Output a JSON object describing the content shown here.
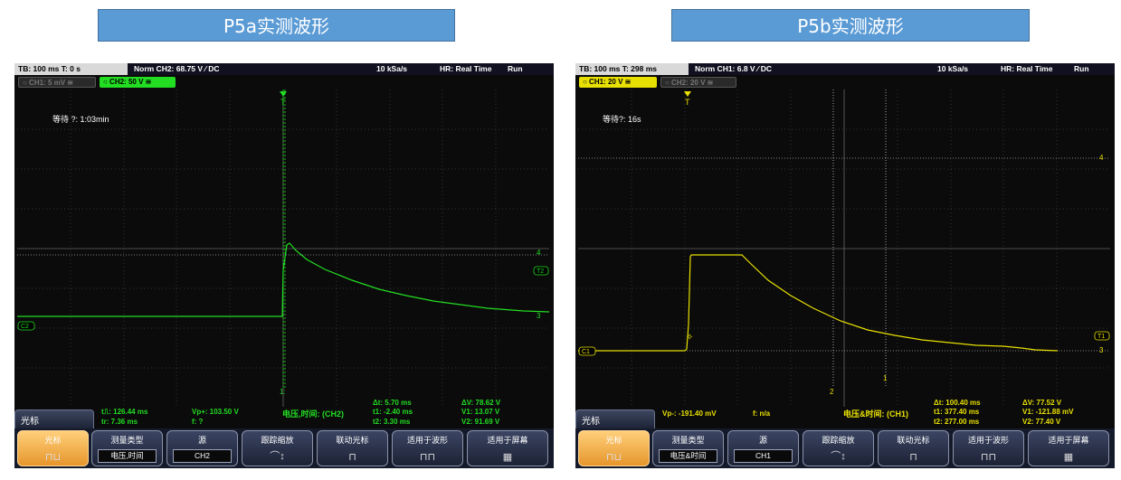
{
  "panels": [
    {
      "title": "P5a实测波形",
      "status": {
        "tb": "TB: 100 ms  T: 0 s",
        "norm": "Norm   CH2: 68.75 V ⁄ DC",
        "rate": "10 kSa/s",
        "hr": "HR: Real Time",
        "run": "Run"
      },
      "ch1": "○ CH1: 5 mV ≅",
      "ch2": "○ CH2: 50 V ≅",
      "wait": "等待 ?: 1:03min",
      "trig_label": "T",
      "markers": {
        "right_top": "4",
        "right_mid": "T2",
        "right_bot": "3",
        "left": "C2",
        "cursor_bottom": "1:"
      },
      "meas": [
        "t⎍: 126.44 ms",
        "tr: 7.36 ms",
        "Vp+: 103.50 V",
        "f: ?",
        "电压,时间: (CH2)",
        "Δt: 5.70 ms",
        "t1: -2.40 ms",
        "t2: 3.30 ms",
        "ΔV: 78.62 V",
        "V1: 13.07 V",
        "V2: 91.69 V"
      ],
      "tab": "光标",
      "softkeys": {
        "cursor": "光标",
        "type": "测量类型",
        "type_val": "电压,时间",
        "src": "源",
        "src_val": "CH2",
        "track": "跟踪缩放",
        "link": "联动光标",
        "fit_wave": "适用于波形",
        "fit_screen": "适用于屏幕"
      },
      "colors": {
        "trace": "#22dd22"
      }
    },
    {
      "title": "P5b实测波形",
      "status": {
        "tb": "TB: 100 ms  T: 298 ms",
        "norm": "Norm   CH1: 6.8 V ⁄ DC",
        "rate": "10 kSa/s",
        "hr": "HR: Real Time",
        "run": "Run"
      },
      "ch1": "○ CH1: 20 V ≅",
      "ch2": "○ CH2: 20 V ≅",
      "wait": "等待?: 16s",
      "trig_label": "T",
      "markers": {
        "right_top": "4",
        "right_mid": "T1",
        "right_bot": "3",
        "left": "C1",
        "c2": "2",
        "c1": "1"
      },
      "meas": [
        "Vp-: -191.40 mV",
        "f: n/a",
        "电压&时间: (CH1)",
        "Δt: 100.40 ms",
        "t1: 377.40 ms",
        "t2: 277.00 ms",
        "ΔV: 77.52 V",
        "V1: -121.88 mV",
        "V2: 77.40 V"
      ],
      "tab": "光标",
      "softkeys": {
        "cursor": "光标",
        "type": "测量类型",
        "type_val": "电压&时间",
        "src": "源",
        "src_val": "CH1",
        "track": "跟踪缩放",
        "link": "联动光标",
        "fit_wave": "适用于波形",
        "fit_screen": "适用于屏幕"
      },
      "colors": {
        "trace": "#e8e000"
      }
    }
  ]
}
